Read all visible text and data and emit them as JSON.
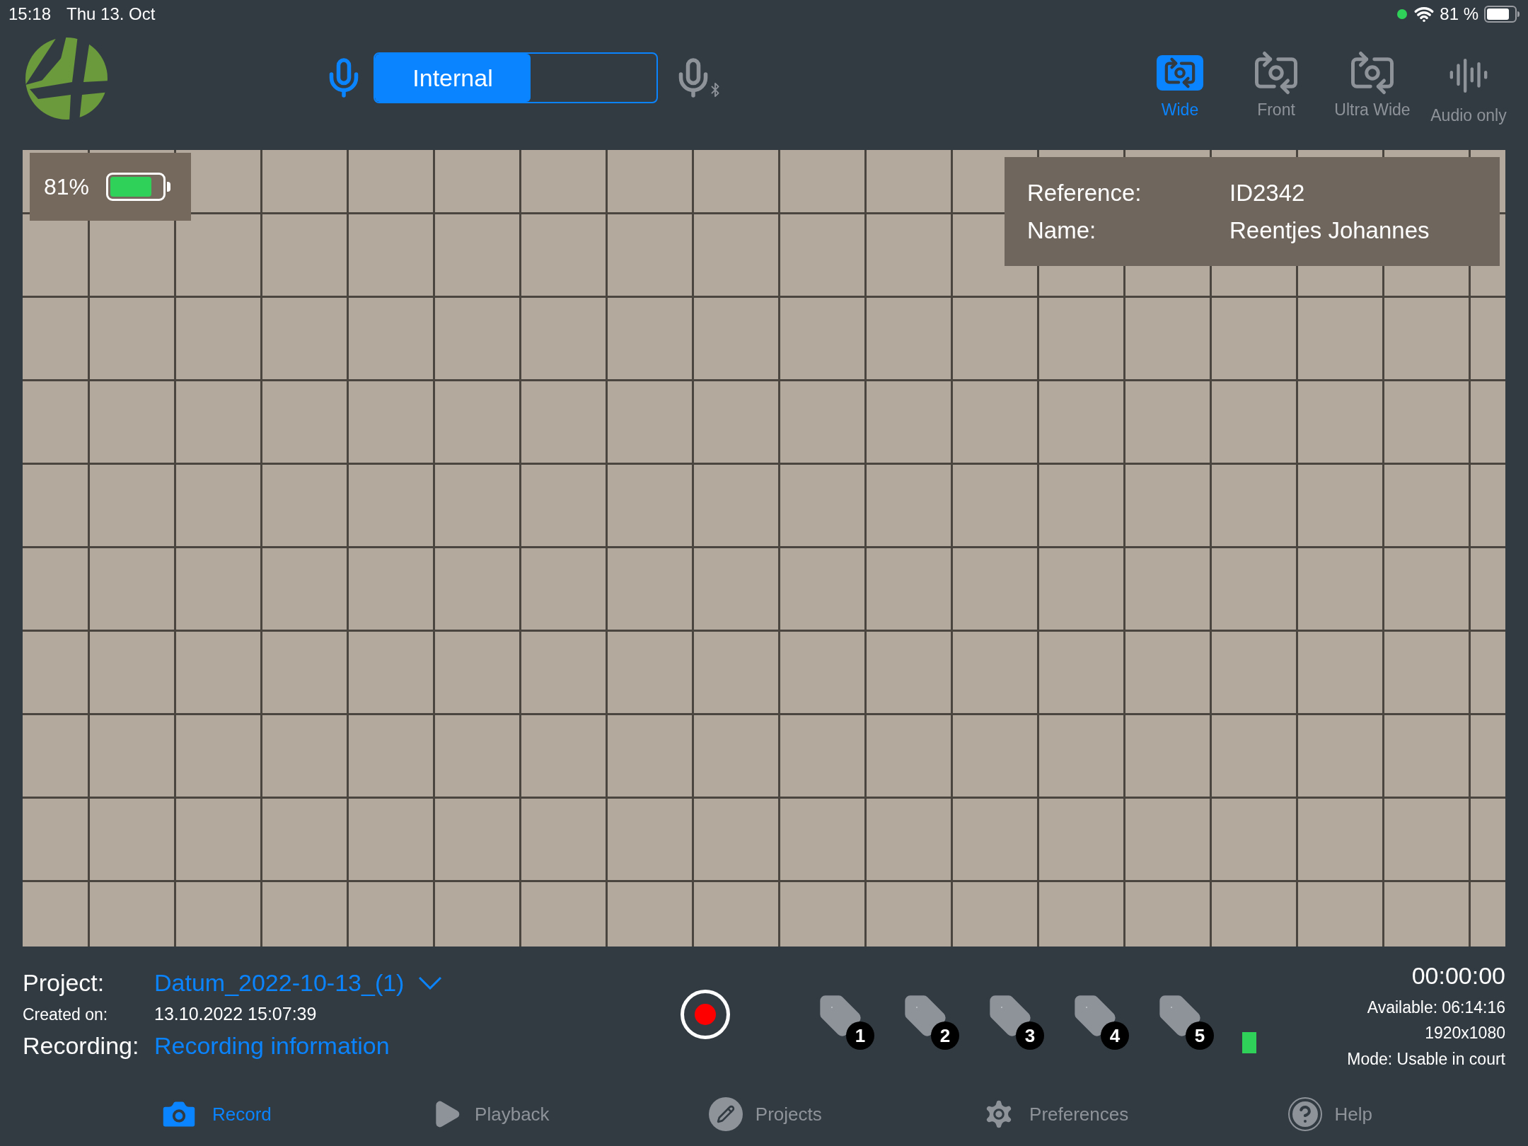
{
  "status_bar": {
    "time": "15:18",
    "date": "Thu 13. Oct",
    "battery": "81 %"
  },
  "mic_source": {
    "label": "Internal",
    "internal": true
  },
  "cameras": [
    {
      "label": "Wide",
      "selected": true,
      "kind": "camera"
    },
    {
      "label": "Front",
      "selected": false,
      "kind": "camera"
    },
    {
      "label": "Ultra Wide",
      "selected": false,
      "kind": "camera"
    },
    {
      "label": "Audio only",
      "selected": false,
      "kind": "audio"
    }
  ],
  "preview": {
    "battery": {
      "reading": "81%",
      "level": 0.81
    },
    "info": [
      {
        "label": "Reference:",
        "value": "ID2342"
      },
      {
        "label": "Name:",
        "value": "Reentjes Johannes"
      }
    ]
  },
  "project": {
    "project_label": "Project:",
    "project_name": "Datum_2022-10-13_(1)",
    "created_label": "Created on:",
    "created": "13.10.2022 15:07:39",
    "recording_label": "Recording:",
    "recording_link": "Recording information"
  },
  "tags": [
    "1",
    "2",
    "3",
    "4",
    "5"
  ],
  "stats": {
    "elapsed": "00:00:00",
    "available": "Available: 06:14:16",
    "resolution": "1920x1080",
    "mode": "Mode: Usable in court"
  },
  "tabs": [
    {
      "label": "Record",
      "selected": true,
      "kind": "camera"
    },
    {
      "label": "Playback",
      "selected": false,
      "kind": "play"
    },
    {
      "label": "Projects",
      "selected": false,
      "kind": "pencil"
    },
    {
      "label": "Preferences",
      "selected": false,
      "kind": "gear"
    },
    {
      "label": "Help",
      "selected": false,
      "kind": "help"
    }
  ]
}
